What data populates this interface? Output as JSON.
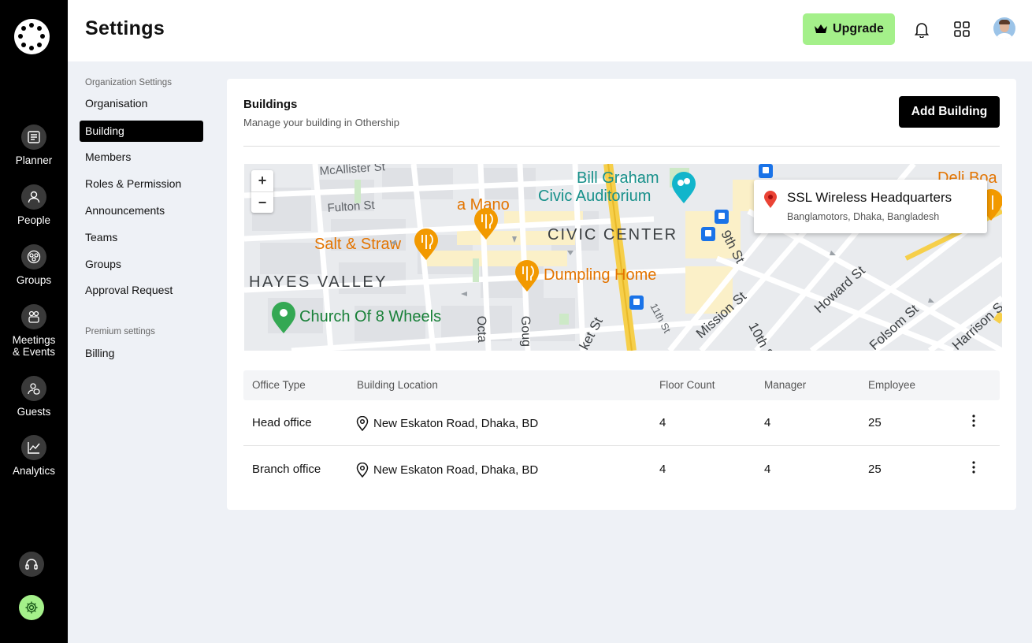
{
  "rail": {
    "items": [
      {
        "label": "Planner",
        "icon": "planner-icon"
      },
      {
        "label": "People",
        "icon": "person-icon"
      },
      {
        "label": "Groups",
        "icon": "groups-icon"
      },
      {
        "label_line1": "Meetings",
        "label_line2": "& Events",
        "icon": "meetings-icon"
      },
      {
        "label": "Guests",
        "icon": "guests-icon"
      },
      {
        "label": "Analytics",
        "icon": "analytics-icon"
      }
    ],
    "bottom": [
      {
        "icon": "headset-icon"
      },
      {
        "icon": "gear-icon",
        "active": true
      }
    ]
  },
  "header": {
    "title": "Settings",
    "upgrade_label": "Upgrade"
  },
  "settings_menu": {
    "org_caption": "Organization Settings",
    "org_items": [
      "Organisation",
      "Building",
      "Members",
      "Roles & Permission",
      "Announcements",
      "Teams",
      "Groups",
      "Approval Request"
    ],
    "active_item": "Building",
    "premium_caption": "Premium settings",
    "premium_items": [
      "Billing"
    ]
  },
  "buildings": {
    "title": "Buildings",
    "subtitle": "Manage your building in Othership",
    "add_label": "Add Building"
  },
  "map": {
    "zoom_in": "+",
    "zoom_out": "−",
    "popup_title": "SSL Wireless Headquarters",
    "popup_subtitle": "Banglamotors, Dhaka, Bangladesh",
    "labels": {
      "mcallister": "McAllister St",
      "fulton": "Fulton St",
      "bill_graham_1": "Bill Graham",
      "bill_graham_2": "Civic Auditorium",
      "a_mano": "a Mano",
      "civic_center": "CIVIC CENTER",
      "salt_straw": "Salt & Straw",
      "hayes_valley": "HAYES VALLEY",
      "dumpling_home": "Dumpling Home",
      "church": "Church Of 8 Wheels",
      "ninth": "9th St",
      "howard": "Howard St",
      "mission": "Mission St",
      "folsom": "Folsom St",
      "harrison": "Harrison S",
      "tenth": "10th S",
      "eleventh": "11th St",
      "market": "ket St",
      "octavia": "Octa",
      "gough": "Goug",
      "deli": "Deli Boa"
    }
  },
  "table": {
    "headers": [
      "Office Type",
      "Building Location",
      "Floor Count",
      "Manager",
      "Employee"
    ],
    "rows": [
      {
        "type": "Head office",
        "location": "New Eskaton Road, Dhaka, BD",
        "floors": "4",
        "manager": "4",
        "employee": "25"
      },
      {
        "type": "Branch office",
        "location": "New Eskaton Road, Dhaka, BD",
        "floors": "4",
        "manager": "4",
        "employee": "25"
      }
    ]
  },
  "colors": {
    "accent": "#a4f08a",
    "rail": "#000000",
    "background": "#eef1f6"
  }
}
